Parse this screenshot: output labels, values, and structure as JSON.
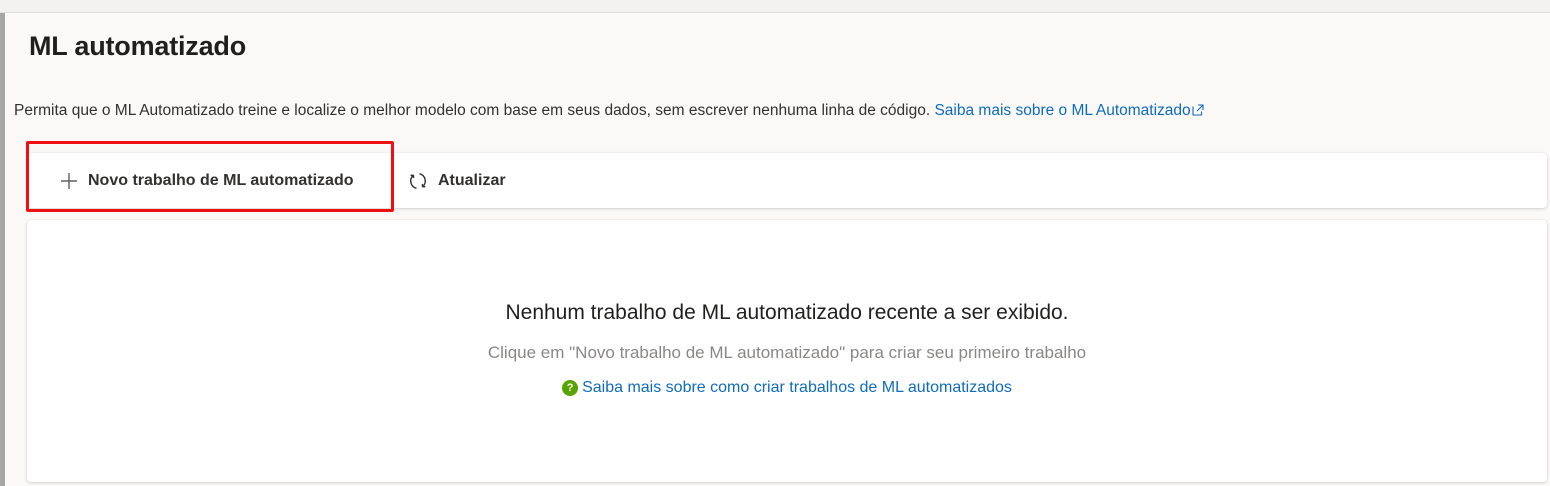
{
  "page": {
    "title": "ML automatizado",
    "description": "Permita que o ML Automatizado treine e localize o melhor modelo com base em seus dados, sem escrever nenhuma linha de código.",
    "learn_more_link": "Saiba mais sobre o ML Automatizado"
  },
  "toolbar": {
    "new_job_label": "Novo trabalho de ML automatizado",
    "refresh_label": "Atualizar"
  },
  "empty_state": {
    "title": "Nenhum trabalho de ML automatizado recente a ser exibido.",
    "subtitle": "Clique em \"Novo trabalho de ML automatizado\" para criar seu primeiro trabalho",
    "help_link": "Saiba mais sobre como criar trabalhos de ML automatizados"
  },
  "icons": {
    "new": "add-icon",
    "refresh": "refresh-icon",
    "external": "external-link-icon",
    "help": "help-circle-icon"
  },
  "colors": {
    "link": "#0f6cbd",
    "highlight": "#ee1111",
    "help_icon": "#57a300"
  }
}
